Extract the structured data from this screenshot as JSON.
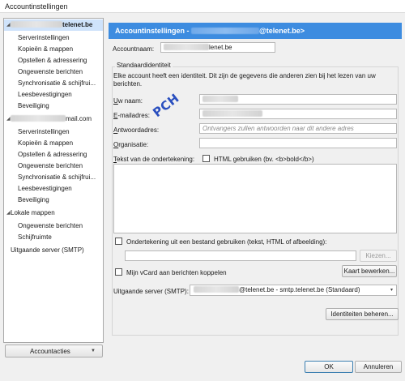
{
  "window": {
    "title": "Accountinstellingen"
  },
  "sidebar": {
    "account1": {
      "name_suffix": "telenet.be"
    },
    "account1_items": [
      "Serverinstellingen",
      "Kopieën & mappen",
      "Opstellen & adressering",
      "Ongewenste berichten",
      "Synchronisatie & schijfrui...",
      "Leesbevestigingen",
      "Beveiliging"
    ],
    "account2": {
      "name_suffix": "mail.com"
    },
    "account2_items": [
      "Serverinstellingen",
      "Kopieën & mappen",
      "Opstellen & adressering",
      "Ongewenste berichten",
      "Synchronisatie & schijfrui...",
      "Leesbevestigingen",
      "Beveiliging"
    ],
    "local": {
      "name": "Lokale mappen"
    },
    "local_items": [
      "Ongewenste berichten",
      "Schijfruimte"
    ],
    "outgoing": "Uitgaande server (SMTP)",
    "account_actions_label": "Accountacties",
    "account_actions_caret": "▼"
  },
  "header": {
    "prefix": "Accountinstellingen - ",
    "suffix": "@telenet.be>"
  },
  "account_name": {
    "label": "Accountnaam:",
    "value_suffix": "lenet.be"
  },
  "identity": {
    "legend": "Standaardidentiteit",
    "description": "Elke account heeft een identiteit. Dit zijn de gegevens die anderen zien bij het lezen van uw berichten.",
    "name_label": "Uw naam:",
    "email_label": "E-mailadres:",
    "reply_label": "Antwoordadres:",
    "reply_placeholder": "Ontvangers zullen antwoorden naar dit andere adres",
    "org_label": "Organisatie:",
    "signature_label": "Tekst van de ondertekening:",
    "html_label": "HTML gebruiken (bv. <b>bold</b>)",
    "file_sig_label": "Ondertekening uit een bestand gebruiken (tekst, HTML of afbeelding):",
    "choose_label": "Kiezen...",
    "vcard_label": "Mijn vCard aan berichten koppelen",
    "vcard_edit_label": "Kaart bewerken...",
    "smtp_label": "Uitgaande server (SMTP):",
    "smtp_value_suffix": "@telenet.be - smtp.telenet.be (Standaard)",
    "smtp_caret": "▾",
    "manage_label": "Identiteiten beheren..."
  },
  "stamp": "PCH",
  "footer": {
    "ok": "OK",
    "cancel": "Annuleren"
  },
  "icons": {
    "expanded": "◢"
  }
}
